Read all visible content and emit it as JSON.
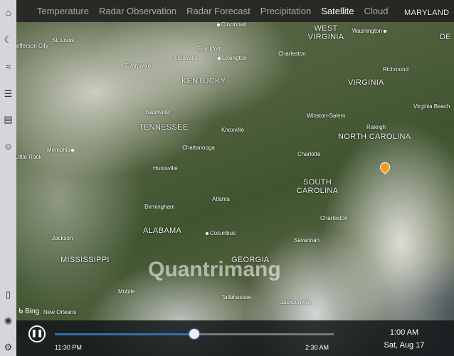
{
  "tabs": [
    {
      "label": "Temperature"
    },
    {
      "label": "Radar Observation"
    },
    {
      "label": "Radar Forecast"
    },
    {
      "label": "Precipitation"
    },
    {
      "label": "Satellite",
      "active": true
    },
    {
      "label": "Cloud"
    }
  ],
  "sidebar": {
    "icons": [
      "home-icon",
      "radar-icon",
      "wave-icon",
      "list-icon",
      "news-icon",
      "smiley-icon",
      "tablet-icon",
      "user-icon",
      "gear-icon"
    ]
  },
  "map": {
    "states": [
      "KENTUCKY",
      "TENNESSEE",
      "WEST VIRGINIA",
      "VIRGINIA",
      "NORTH CAROLINA",
      "SOUTH CAROLINA",
      "ALABAMA",
      "MISSISSIPPI",
      "GEORGIA",
      "MARYLAND",
      "DE"
    ],
    "cities": [
      "Cincinnati",
      "Frankfort",
      "Louisville",
      "Lexington",
      "Evansville",
      "St. Louis",
      "Jefferson City",
      "Charleston",
      "Washington",
      "Richmond",
      "Virginia Beach",
      "Nashville",
      "Knoxville",
      "Winston-Salem",
      "Raleigh",
      "Memphis",
      "Little Rock",
      "Chattanooga",
      "Huntsville",
      "Charlotte",
      "Birmingham",
      "Atlanta",
      "Columbus",
      "Jackson",
      "Savannah",
      "Mobile",
      "Tallahassee",
      "Jacksonville",
      "New Orleans",
      "Charleston"
    ],
    "attribution": "Bing",
    "watermark": "Quantrimang"
  },
  "player": {
    "state": "playing",
    "start_label": "11:30 PM",
    "end_label": "2:30 AM",
    "progress": 0.5,
    "current_time": "1:00 AM",
    "current_date": "Sat, Aug 17"
  },
  "colors": {
    "accent": "#2f6fad",
    "pin": "#f39a1e"
  }
}
